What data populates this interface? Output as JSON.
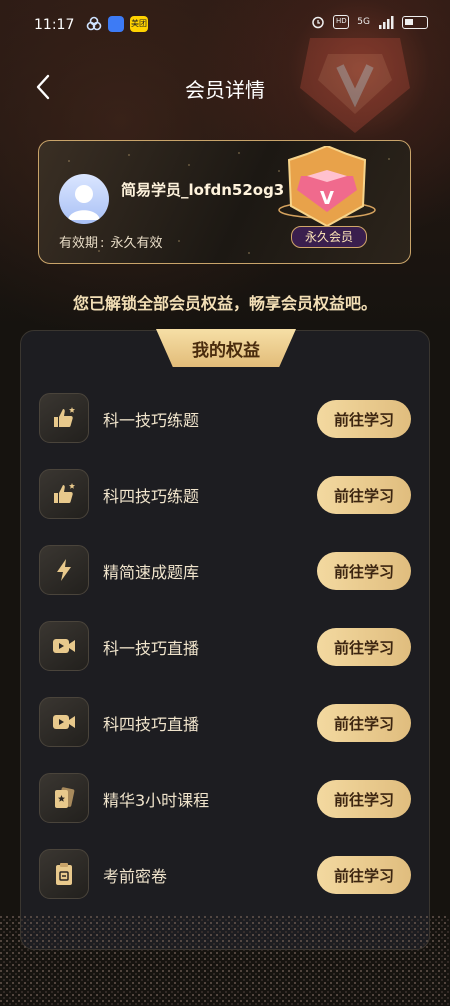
{
  "status_bar": {
    "time": "11:17",
    "app_badge_label": "美团",
    "hd_label": "HD",
    "network_label": "5G"
  },
  "header": {
    "title": "会员详情"
  },
  "member_card": {
    "username": "简易学员_lofdn52og3",
    "validity_label": "有效期",
    "validity_value": "永久有效",
    "badge_label": "永久会员",
    "badge_letter": "V"
  },
  "tagline": "您已解锁全部会员权益，畅享会员权益吧。",
  "benefits": {
    "title": "我的权益",
    "items": [
      {
        "label": "科一技巧练题",
        "button": "前往学习",
        "icon": "thumbs-up-star-icon"
      },
      {
        "label": "科四技巧练题",
        "button": "前往学习",
        "icon": "thumbs-up-star-icon"
      },
      {
        "label": "精简速成题库",
        "button": "前往学习",
        "icon": "lightning-icon"
      },
      {
        "label": "科一技巧直播",
        "button": "前往学习",
        "icon": "video-camera-icon"
      },
      {
        "label": "科四技巧直播",
        "button": "前往学习",
        "icon": "video-camera-icon"
      },
      {
        "label": "精华3小时课程",
        "button": "前往学习",
        "icon": "course-cards-icon"
      },
      {
        "label": "考前密卷",
        "button": "前往学习",
        "icon": "clipboard-icon"
      }
    ]
  },
  "colors": {
    "accent_gold": "#e2bc79",
    "background": "#16130f",
    "panel": "#1d1d21"
  }
}
